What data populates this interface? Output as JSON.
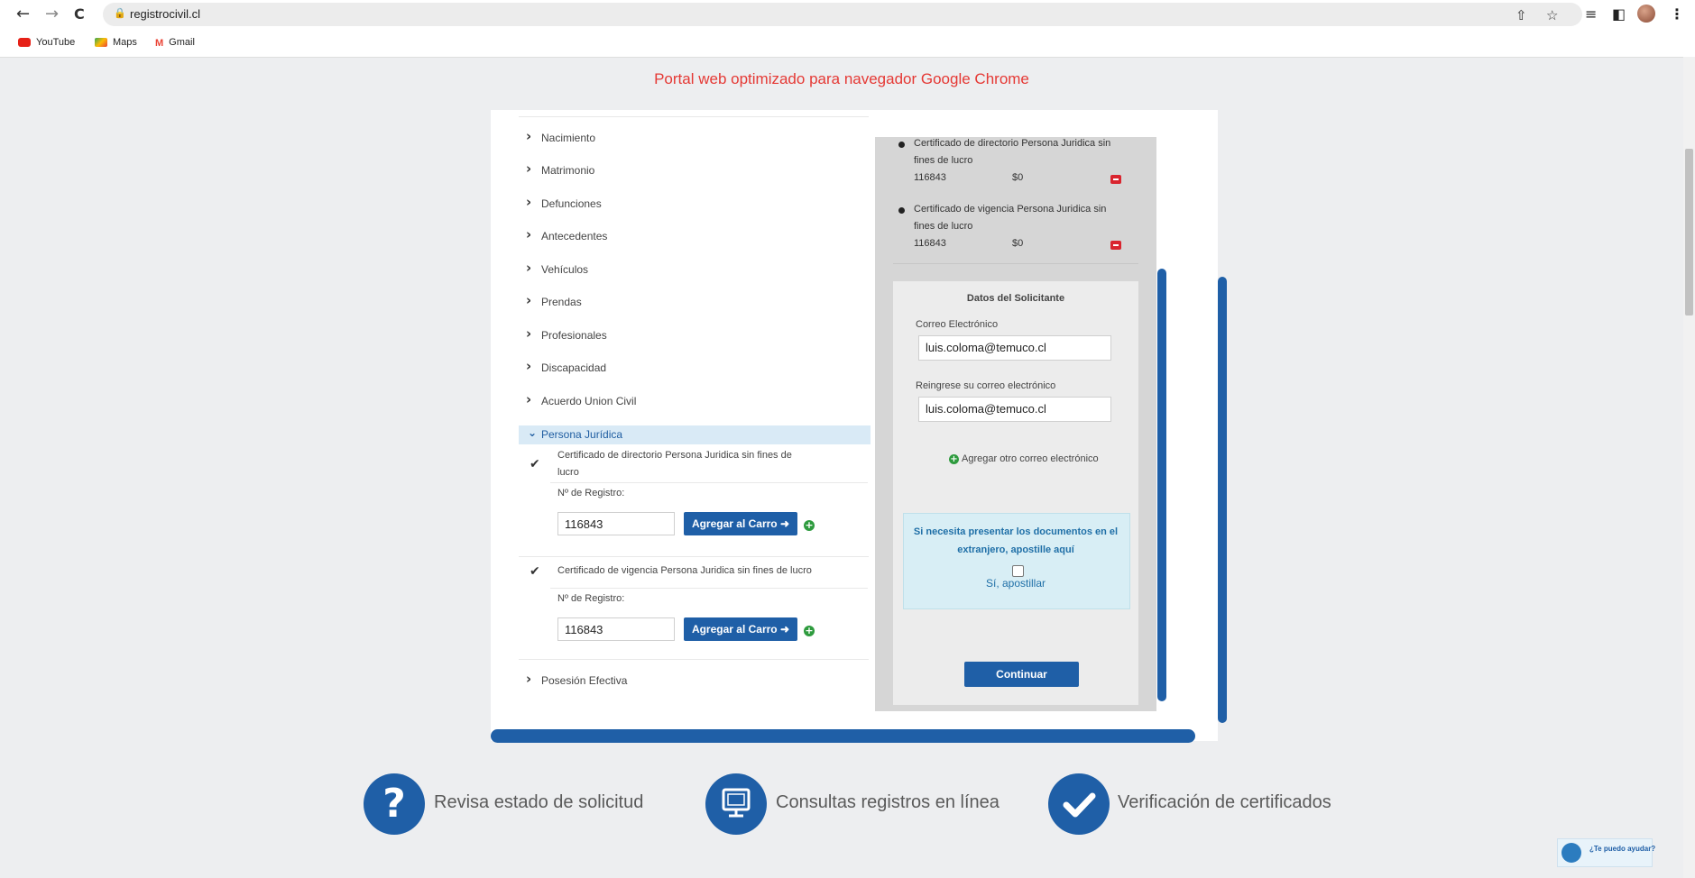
{
  "browser": {
    "url": "registrocivil.cl",
    "back_icon": "←",
    "forward_icon": "→",
    "reload_icon": "C",
    "bookmarks": [
      "YouTube",
      "Maps",
      "Gmail"
    ]
  },
  "banner": "Portal web optimizado para navegador Google Chrome",
  "menu": {
    "items": [
      "Nacimiento",
      "Matrimonio",
      "Defunciones",
      "Antecedentes",
      "Vehículos",
      "Prendas",
      "Profesionales",
      "Discapacidad",
      "Acuerdo Union Civil"
    ],
    "expanded": "Persona Jurídica",
    "last": "Posesión Efectiva"
  },
  "certs": [
    {
      "name_line1": "Certificado de directorio Persona Juridica sin fines de",
      "name_line2": "lucro",
      "registro_label": "Nº de Registro:",
      "registro_value": "116843",
      "button": "Agregar al Carro"
    },
    {
      "name_line1": "Certificado de vigencia Persona Juridica sin fines de lucro",
      "registro_label": "Nº de Registro:",
      "registro_value": "116843",
      "button": "Agregar al Carro"
    }
  ],
  "cart": {
    "items": [
      {
        "line1": "Certificado de directorio Persona Juridica sin",
        "line2": "fines de lucro",
        "code": "116843",
        "price": "$0"
      },
      {
        "line1": "Certificado de vigencia Persona Juridica sin",
        "line2": "fines de lucro",
        "code": "116843",
        "price": "$0"
      }
    ]
  },
  "solicitante": {
    "title": "Datos del Solicitante",
    "email_label": "Correo Electrónico",
    "email_value": "luis.coloma@temuco.cl",
    "reemail_label": "Reingrese su correo electrónico",
    "reemail_value": "luis.coloma@temuco.cl",
    "add_email": "Agregar otro correo electrónico",
    "apostille_line1": "Si necesita presentar los documentos en el",
    "apostille_line2": "extranjero, apostille aquí",
    "apostille_check": "Sí, apostillar",
    "continue": "Continuar"
  },
  "bottom_links": [
    "Revisa estado de solicitud",
    "Consultas registros en línea",
    "Verificación de certificados"
  ],
  "help_widget": "¿Te puedo ayudar?",
  "colors": {
    "accent": "#1f5fa7",
    "banner": "#e53935",
    "danger": "#d9252f",
    "success": "#2e9b3e"
  }
}
